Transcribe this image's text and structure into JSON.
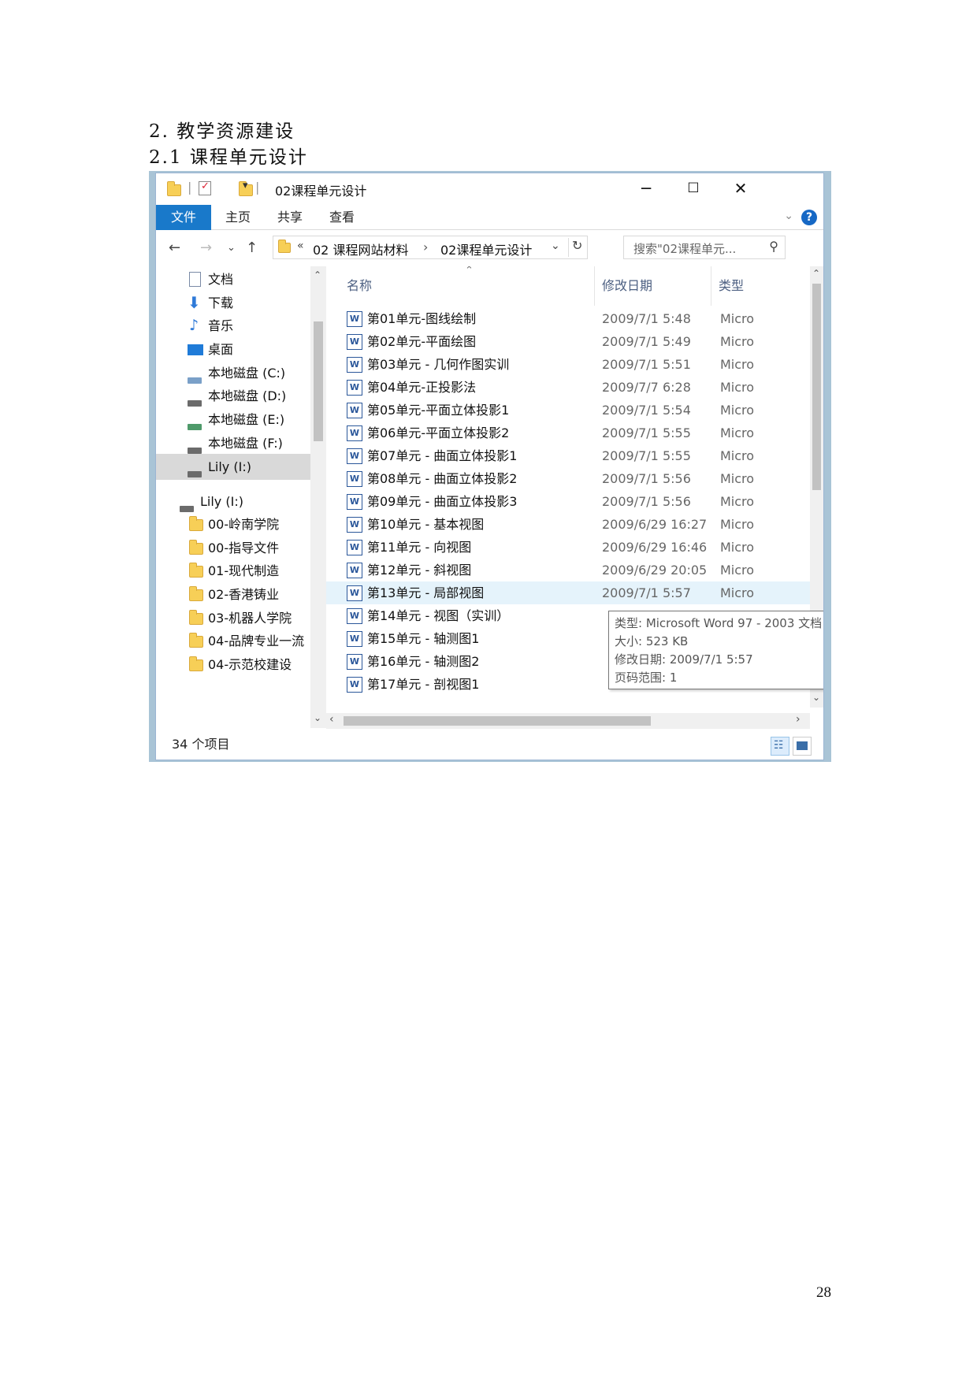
{
  "document": {
    "heading_1": "2. 教学资源建设",
    "heading_2": "2.1 课程单元设计",
    "page_number": "28"
  },
  "explorer": {
    "window_title": "02课程单元设计",
    "window_controls": {
      "minimize": "─",
      "maximize": "☐",
      "close": "✕"
    },
    "ribbon_tabs": [
      {
        "label": "文件",
        "active": true
      },
      {
        "label": "主页",
        "active": false
      },
      {
        "label": "共享",
        "active": false
      },
      {
        "label": "查看",
        "active": false
      }
    ],
    "address": {
      "overflow": "«",
      "segment_1": "02 课程网站材料",
      "separator": "›",
      "segment_2": "02课程单元设计"
    },
    "search_placeholder": "搜索\"02课程单元...",
    "nav_items": [
      {
        "label": "文档",
        "icon": "document-icon"
      },
      {
        "label": "下载",
        "icon": "download-icon"
      },
      {
        "label": "音乐",
        "icon": "music-icon"
      },
      {
        "label": "桌面",
        "icon": "desktop-icon"
      },
      {
        "label": "本地磁盘 (C:)",
        "icon": "drive-icon"
      },
      {
        "label": "本地磁盘 (D:)",
        "icon": "drive-icon"
      },
      {
        "label": "本地磁盘 (E:)",
        "icon": "drive-icon"
      },
      {
        "label": "本地磁盘 (F:)",
        "icon": "drive-icon"
      },
      {
        "label": "Lily (I:)",
        "icon": "drive-icon",
        "selected": true
      },
      {
        "label": "Lily (I:)",
        "icon": "drive-icon"
      },
      {
        "label": "00-岭南学院",
        "icon": "folder-icon"
      },
      {
        "label": "00-指导文件",
        "icon": "folder-icon"
      },
      {
        "label": "01-现代制造",
        "icon": "folder-icon"
      },
      {
        "label": "02-香港铸业",
        "icon": "folder-icon"
      },
      {
        "label": "03-机器人学院",
        "icon": "folder-icon"
      },
      {
        "label": "04-品牌专业一流",
        "icon": "folder-icon"
      },
      {
        "label": "04-示范校建设",
        "icon": "folder-icon"
      }
    ],
    "columns": {
      "name": "名称",
      "date": "修改日期",
      "type": "类型"
    },
    "files": [
      {
        "name": "第01单元-图线绘制",
        "date": "2009/7/1 5:48",
        "type": "Micro"
      },
      {
        "name": "第02单元-平面绘图",
        "date": "2009/7/1 5:49",
        "type": "Micro"
      },
      {
        "name": "第03单元 - 几何作图实训",
        "date": "2009/7/1 5:51",
        "type": "Micro"
      },
      {
        "name": "第04单元-正投影法",
        "date": "2009/7/7 6:28",
        "type": "Micro"
      },
      {
        "name": "第05单元-平面立体投影1",
        "date": "2009/7/1 5:54",
        "type": "Micro"
      },
      {
        "name": "第06单元-平面立体投影2",
        "date": "2009/7/1 5:55",
        "type": "Micro"
      },
      {
        "name": "第07单元 - 曲面立体投影1",
        "date": "2009/7/1 5:55",
        "type": "Micro"
      },
      {
        "name": "第08单元 - 曲面立体投影2",
        "date": "2009/7/1 5:56",
        "type": "Micro"
      },
      {
        "name": "第09单元 - 曲面立体投影3",
        "date": "2009/7/1 5:56",
        "type": "Micro"
      },
      {
        "name": "第10单元 - 基本视图",
        "date": "2009/6/29 16:27",
        "type": "Micro"
      },
      {
        "name": "第11单元 - 向视图",
        "date": "2009/6/29 16:46",
        "type": "Micro"
      },
      {
        "name": "第12单元 - 斜视图",
        "date": "2009/6/29 20:05",
        "type": "Micro"
      },
      {
        "name": "第13单元 - 局部视图",
        "date": "2009/7/1 5:57",
        "type": "Micro",
        "hover": true
      },
      {
        "name": "第14单元 - 视图（实训）",
        "date": "",
        "type": ""
      },
      {
        "name": "第15单元 - 轴测图1",
        "date": "",
        "type": ""
      },
      {
        "name": "第16单元 - 轴测图2",
        "date": "",
        "type": ""
      },
      {
        "name": "第17单元 - 剖视图1",
        "date": "",
        "type": ""
      }
    ],
    "tooltip": {
      "type": "类型: Microsoft Word 97 - 2003 文档",
      "size": "大小: 523 KB",
      "modified": "修改日期: 2009/7/1 5:57",
      "pages": "页码范围: 1"
    },
    "status": "34 个项目",
    "colors": {
      "accent": "#1979ca",
      "hover_row": "#e5f3fb",
      "selected_nav": "#d9d9d9",
      "folder": "#f7cf57"
    }
  }
}
